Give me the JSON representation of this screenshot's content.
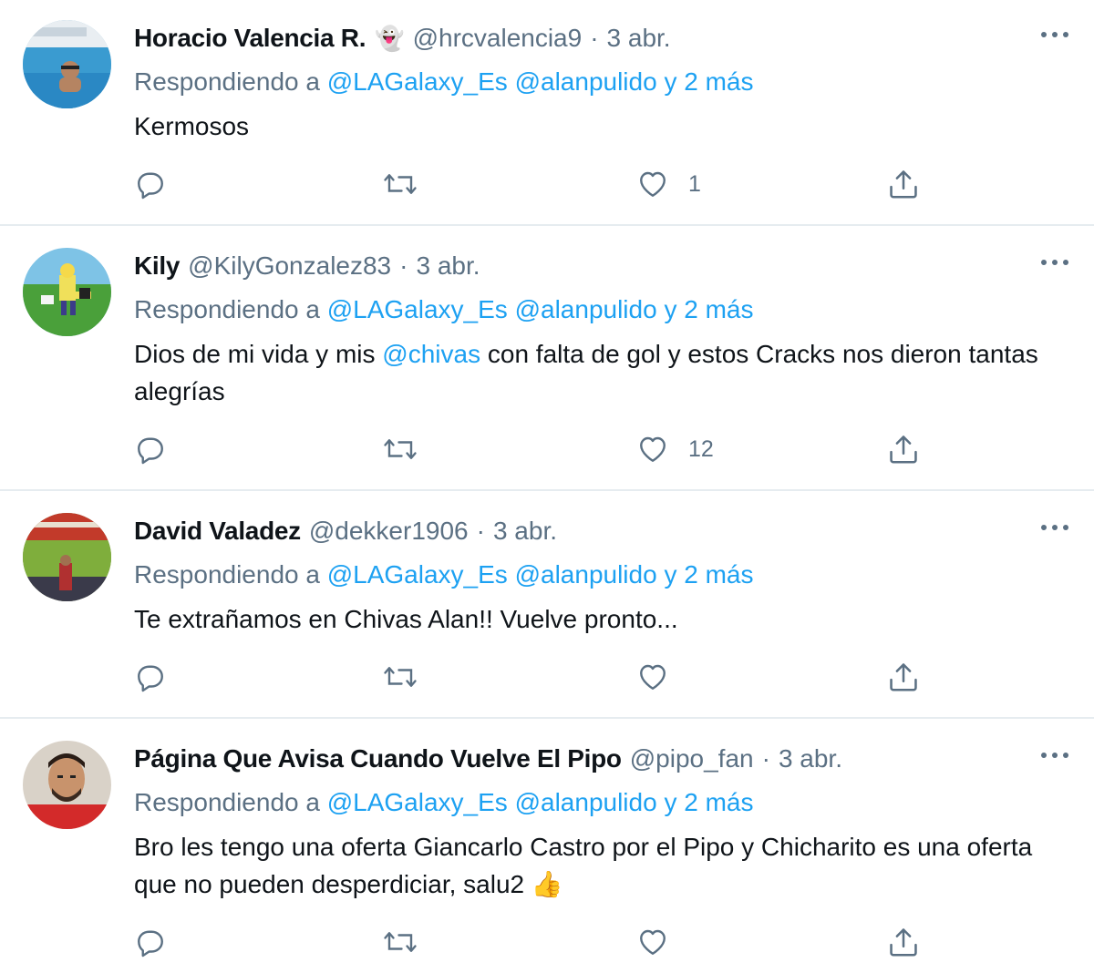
{
  "tweets": [
    {
      "name": "Horacio Valencia R.",
      "badge": "👻",
      "handle": "@hrcvalencia9",
      "dot": "·",
      "date": "3 abr.",
      "replying_prefix": "Respondiendo a",
      "replying_mentions": "@LAGalaxy_Es @alanpulido y 2 más",
      "text_parts": [
        "Kermosos"
      ],
      "like_count": "1",
      "avatar_icon": "pool-photo-avatar"
    },
    {
      "name": "Kily",
      "handle": "@KilyGonzalez83",
      "dot": "·",
      "date": "3 abr.",
      "replying_prefix": "Respondiendo a",
      "replying_mentions": "@LAGalaxy_Es @alanpulido y 2 más",
      "text_before": "Dios de mi vida y mis ",
      "text_mention": "@chivas",
      "text_after": " con falta de gol y estos Cracks nos dieron tantas alegrías",
      "like_count": "12",
      "avatar_icon": "cartoon-avatar"
    },
    {
      "name": "David Valadez",
      "handle": "@dekker1906",
      "dot": "·",
      "date": "3 abr.",
      "replying_prefix": "Respondiendo a",
      "replying_mentions": "@LAGalaxy_Es @alanpulido y 2 más",
      "text_parts": [
        "Te extrañamos en Chivas Alan!! Vuelve pronto..."
      ],
      "like_count": "",
      "avatar_icon": "stadium-photo-avatar"
    },
    {
      "name": "Página Que Avisa Cuando Vuelve El Pipo",
      "handle": "@pipo_fan",
      "dot": "·",
      "date": "3 abr.",
      "replying_prefix": "Respondiendo a",
      "replying_mentions": "@LAGalaxy_Es @alanpulido y 2 más",
      "text_parts": [
        "Bro les tengo una oferta Giancarlo Castro por el Pipo y Chicharito es una oferta que no pueden desperdiciar, salu2"
      ],
      "text_emoji": "👍",
      "like_count": "",
      "avatar_icon": "player-photo-avatar"
    }
  ],
  "icons": {
    "reply": "reply-icon",
    "retweet": "retweet-icon",
    "like": "heart-icon",
    "share": "share-icon",
    "more": "more-options-icon"
  },
  "colors": {
    "text": "#0f1419",
    "secondary": "#5b7083",
    "link": "#1da1f2",
    "divider": "#e6ecf0"
  }
}
